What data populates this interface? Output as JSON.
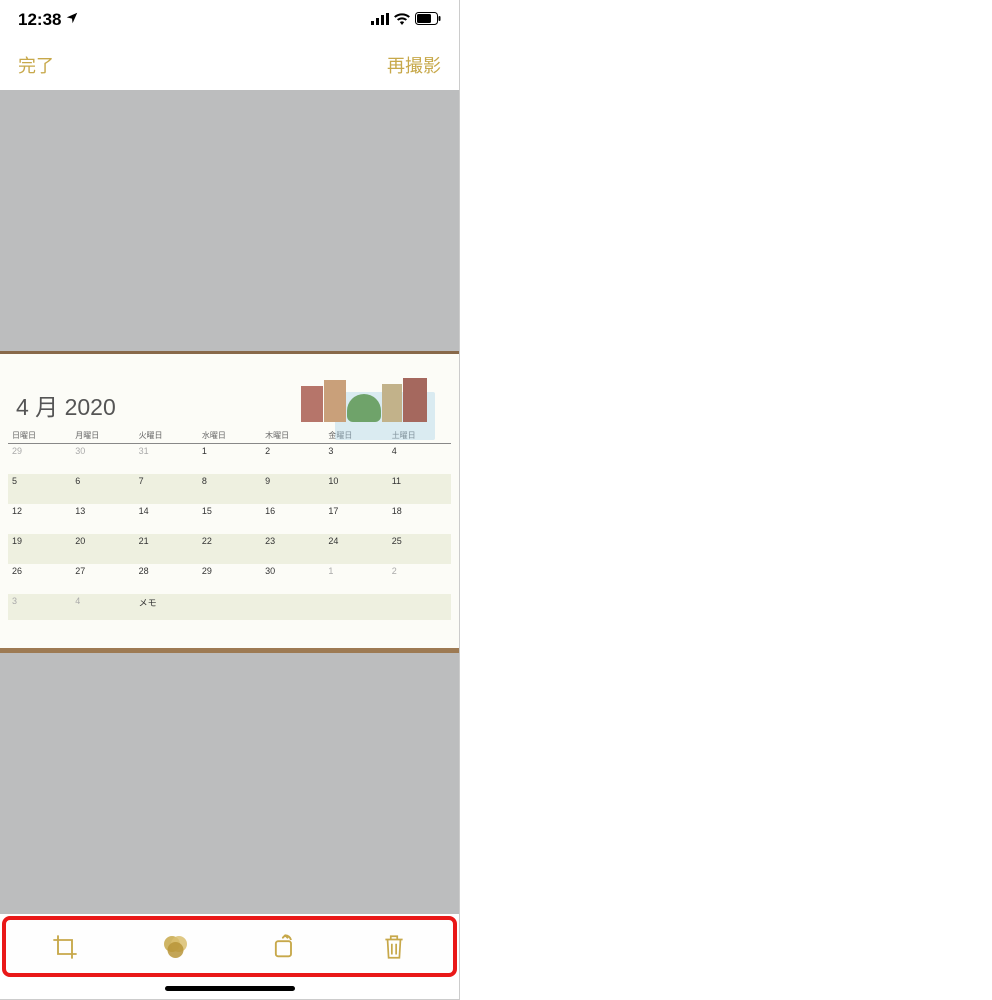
{
  "status": {
    "time": "12:38",
    "location_active": true
  },
  "nav": {
    "done_label": "完了",
    "retake_label": "再撮影"
  },
  "document": {
    "title": "4 月 2020",
    "weekdays": [
      "日曜日",
      "月曜日",
      "火曜日",
      "水曜日",
      "木曜日",
      "金曜日",
      "土曜日"
    ],
    "rows": [
      {
        "shaded": false,
        "cells": [
          {
            "v": "29",
            "dim": true
          },
          {
            "v": "30",
            "dim": true
          },
          {
            "v": "31",
            "dim": true
          },
          {
            "v": "1",
            "dim": false
          },
          {
            "v": "2",
            "dim": false
          },
          {
            "v": "3",
            "dim": false
          },
          {
            "v": "4",
            "dim": false
          }
        ]
      },
      {
        "shaded": true,
        "cells": [
          {
            "v": "5",
            "dim": false
          },
          {
            "v": "6",
            "dim": false
          },
          {
            "v": "7",
            "dim": false
          },
          {
            "v": "8",
            "dim": false
          },
          {
            "v": "9",
            "dim": false
          },
          {
            "v": "10",
            "dim": false
          },
          {
            "v": "11",
            "dim": false
          }
        ]
      },
      {
        "shaded": false,
        "cells": [
          {
            "v": "12",
            "dim": false
          },
          {
            "v": "13",
            "dim": false
          },
          {
            "v": "14",
            "dim": false
          },
          {
            "v": "15",
            "dim": false
          },
          {
            "v": "16",
            "dim": false
          },
          {
            "v": "17",
            "dim": false
          },
          {
            "v": "18",
            "dim": false
          }
        ]
      },
      {
        "shaded": true,
        "cells": [
          {
            "v": "19",
            "dim": false
          },
          {
            "v": "20",
            "dim": false
          },
          {
            "v": "21",
            "dim": false
          },
          {
            "v": "22",
            "dim": false
          },
          {
            "v": "23",
            "dim": false
          },
          {
            "v": "24",
            "dim": false
          },
          {
            "v": "25",
            "dim": false
          }
        ]
      },
      {
        "shaded": false,
        "cells": [
          {
            "v": "26",
            "dim": false
          },
          {
            "v": "27",
            "dim": false
          },
          {
            "v": "28",
            "dim": false
          },
          {
            "v": "29",
            "dim": false
          },
          {
            "v": "30",
            "dim": false
          },
          {
            "v": "1",
            "dim": true
          },
          {
            "v": "2",
            "dim": true
          }
        ]
      },
      {
        "shaded": true,
        "memo": true,
        "cells": [
          {
            "v": "3",
            "dim": true
          },
          {
            "v": "4",
            "dim": true
          },
          {
            "v": "メモ",
            "dim": false,
            "memo_label": true
          },
          {
            "v": "",
            "dim": false
          },
          {
            "v": "",
            "dim": false
          },
          {
            "v": "",
            "dim": false
          },
          {
            "v": "",
            "dim": false
          }
        ]
      }
    ]
  },
  "toolbar": {
    "crop": "crop",
    "filter": "filter",
    "rotate": "rotate",
    "delete": "delete"
  },
  "colors": {
    "accent": "#c7a84a",
    "annotation": "#e91818"
  }
}
